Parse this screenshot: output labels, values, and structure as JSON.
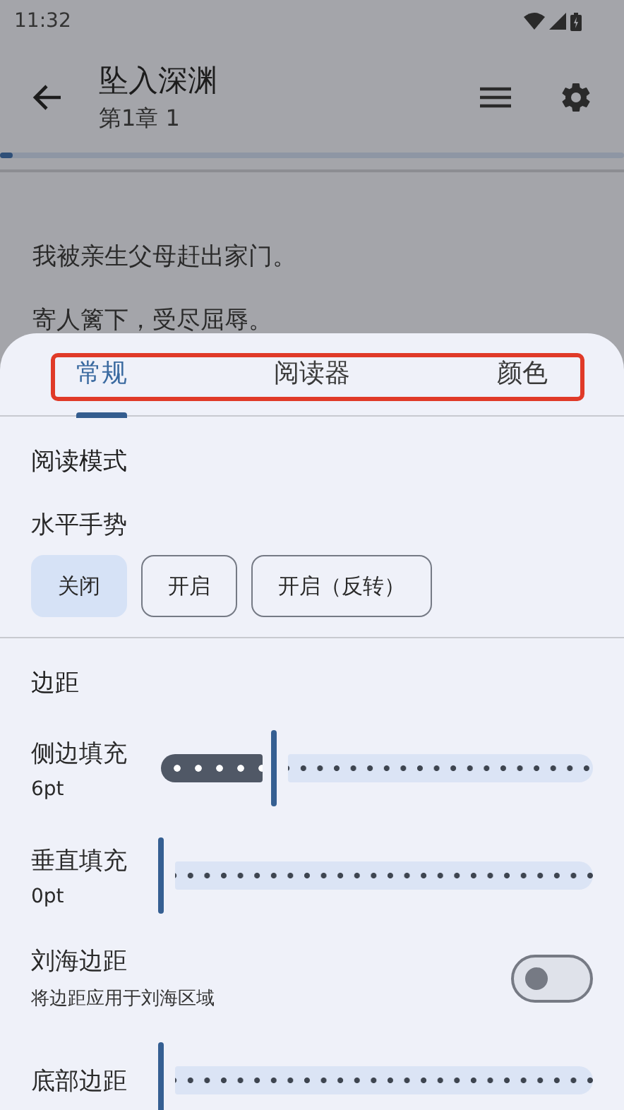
{
  "status_bar": {
    "time": "11:32"
  },
  "app_bar": {
    "title": "坠入深渊",
    "subtitle": "第1章 1"
  },
  "reading_progress": {
    "level": 0.02
  },
  "content": [
    "我被亲生父母赶出家门。",
    "寄人篱下，受尽屈辱。"
  ],
  "sheet": {
    "tabs": [
      {
        "label": "常规",
        "selected": true
      },
      {
        "label": "阅读器",
        "selected": false
      },
      {
        "label": "颜色",
        "selected": false
      }
    ],
    "sections": [
      {
        "title": "阅读模式",
        "items": [
          {
            "kind": "chips",
            "label": "水平手势",
            "options": [
              {
                "label": "关闭",
                "selected": true
              },
              {
                "label": "开启",
                "selected": false
              },
              {
                "label": "开启（反转）",
                "selected": false
              }
            ]
          }
        ]
      },
      {
        "title": "边距",
        "items": [
          {
            "kind": "slider",
            "label": "侧边填充",
            "value": "6pt",
            "level": 0.26
          },
          {
            "kind": "slider",
            "label": "垂直填充",
            "value": "0pt",
            "level": 0
          },
          {
            "kind": "switch",
            "label": "刘海边距",
            "description": "将边距应用于刘海区域",
            "on": false
          },
          {
            "kind": "slider",
            "label": "底部边距",
            "level": 0
          }
        ]
      }
    ]
  }
}
